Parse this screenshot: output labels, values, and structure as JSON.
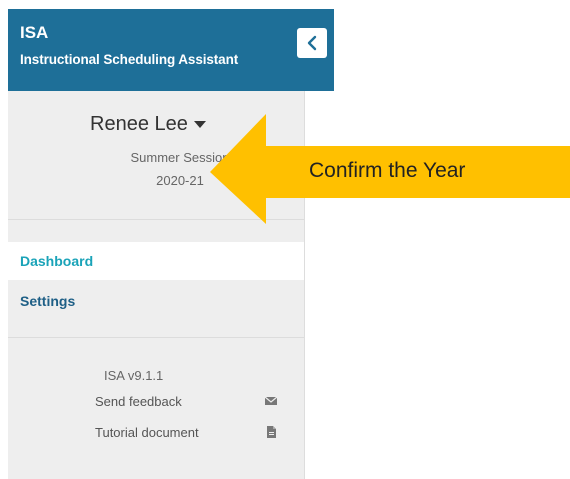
{
  "header": {
    "app_name": "ISA",
    "app_subtitle": "Instructional Scheduling Assistant",
    "background_color": "#1e6f98"
  },
  "user": {
    "name": "Renee Lee",
    "session_term": "Summer Session",
    "session_year": "2020-21"
  },
  "nav": {
    "items": [
      {
        "label": "Dashboard",
        "active": true
      },
      {
        "label": "Settings",
        "active": false
      }
    ]
  },
  "footer": {
    "version": "ISA v9.1.1",
    "feedback_label": "Send feedback",
    "feedback_icon": "envelope-icon",
    "tutorial_label": "Tutorial document",
    "tutorial_icon": "document-icon"
  },
  "annotation": {
    "text": "Confirm the Year",
    "color": "#ffc000"
  },
  "colors": {
    "accent": "#1aa3b8",
    "nav_link": "#1e5f86",
    "sidebar_bg": "#eeeeee"
  }
}
